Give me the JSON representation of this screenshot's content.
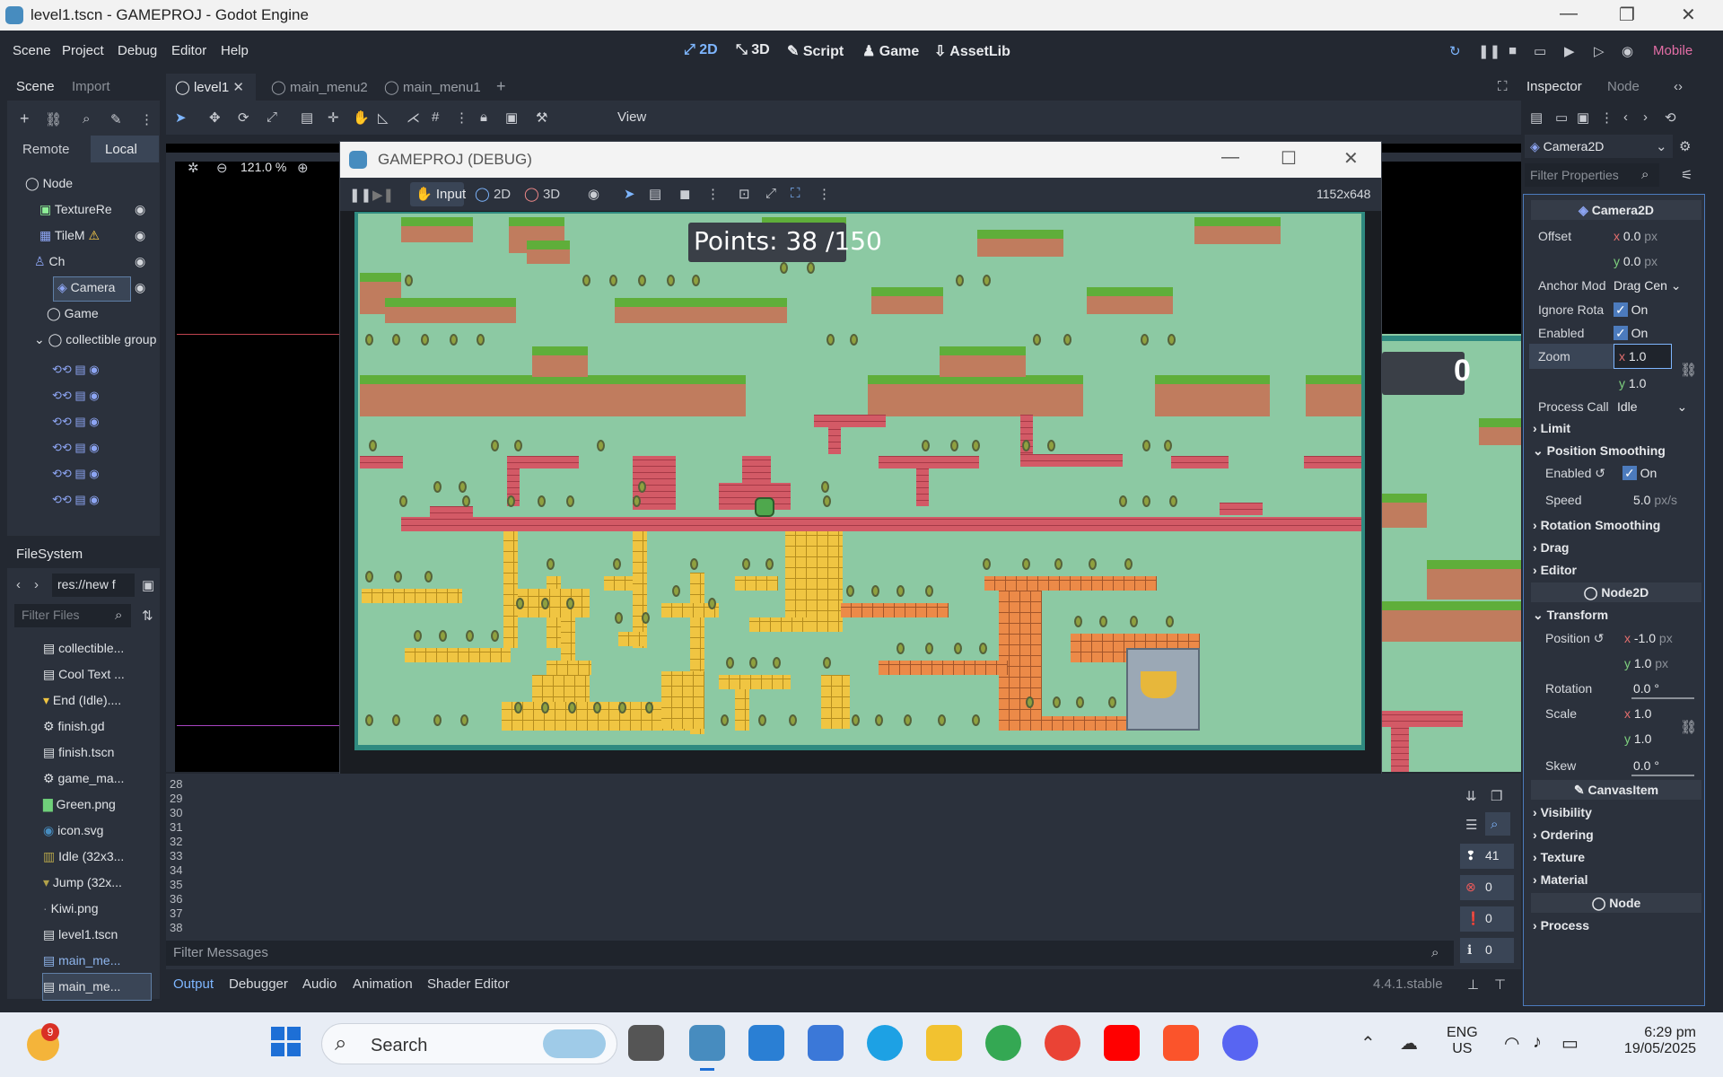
{
  "window": {
    "title": "level1.tscn - GAMEPROJ - Godot Engine"
  },
  "menu": [
    "Scene",
    "Project",
    "Debug",
    "Editor",
    "Help"
  ],
  "workspaces": [
    "2D",
    "3D",
    "Script",
    "Game",
    "AssetLib"
  ],
  "renderer": "Mobile",
  "scene_dock": {
    "tabs": [
      "Scene",
      "Import"
    ],
    "remote": "Remote",
    "local": "Local",
    "nodes": [
      {
        "label": "Node"
      },
      {
        "label": "TextureRe"
      },
      {
        "label": "TileM"
      },
      {
        "label": "Ch"
      },
      {
        "label": "Camera"
      },
      {
        "label": "Game"
      },
      {
        "label": "collectible group"
      }
    ]
  },
  "filesystem": {
    "title": "FileSystem",
    "path": "res://new f",
    "filter_placeholder": "Filter Files",
    "files": [
      "collectible...",
      "Cool Text ...",
      "End (Idle)....",
      "finish.gd",
      "finish.tscn",
      "game_ma...",
      "Green.png",
      "icon.svg",
      "Idle (32x3...",
      "Jump (32x...",
      "Kiwi.png",
      "level1.tscn",
      "main_me...",
      "main_me..."
    ]
  },
  "editor_tabs": [
    "level1",
    "main_menu2",
    "main_menu1"
  ],
  "toolbar": {
    "view": "View",
    "zoom": "121.0 %"
  },
  "game_window": {
    "title": "GAMEPROJ (DEBUG)",
    "input": "Input",
    "mode2d": "2D",
    "mode3d": "3D",
    "resolution": "1152x648",
    "points": "Points: 38 /150"
  },
  "side_score": "0",
  "output": {
    "lines": [
      "28",
      "29",
      "30",
      "31",
      "32",
      "33",
      "34",
      "35",
      "36",
      "37",
      "38"
    ],
    "filter_placeholder": "Filter Messages",
    "counts": [
      "41",
      "0",
      "0",
      "0"
    ],
    "tabs": [
      "Output",
      "Debugger",
      "Audio",
      "Animation",
      "Shader Editor"
    ],
    "version": "4.4.1.stable"
  },
  "inspector": {
    "tabs": [
      "Inspector",
      "Node"
    ],
    "node_type": "Camera2D",
    "filter_placeholder": "Filter Properties",
    "header": "Camera2D",
    "offset_label": "Offset",
    "offset_x": "0.0",
    "offset_y": "0.0",
    "px": "px",
    "anchor_label": "Anchor Mod",
    "anchor_value": "Drag Cen",
    "ignore_label": "Ignore Rota",
    "ignore_value": "On",
    "enabled_label": "Enabled",
    "enabled_value": "On",
    "zoom_label": "Zoom",
    "zoom_x": "1.0",
    "zoom_y": "1.0",
    "process_label": "Process Call",
    "process_value": "Idle",
    "limit": "Limit",
    "pos_smoothing": "Position Smoothing",
    "ps_enabled_label": "Enabled",
    "ps_enabled_value": "On",
    "speed_label": "Speed",
    "speed_value": "5.0",
    "speed_unit": "px/s",
    "rot_smoothing": "Rotation Smoothing",
    "drag": "Drag",
    "editor": "Editor",
    "node2d": "Node2D",
    "transform": "Transform",
    "position_label": "Position",
    "pos_x": "-1.0",
    "pos_y": "1.0",
    "rotation_label": "Rotation",
    "rotation_value": "0.0",
    "scale_label": "Scale",
    "scale_x": "1.0",
    "scale_y": "1.0",
    "skew_label": "Skew",
    "skew_value": "0.0",
    "canvasitem": "CanvasItem",
    "visibility": "Visibility",
    "ordering": "Ordering",
    "texture": "Texture",
    "material": "Material",
    "node": "Node",
    "process": "Process"
  },
  "taskbar": {
    "search": "Search",
    "lang1": "ENG",
    "lang2": "US",
    "time": "6:29 pm",
    "date": "19/05/2025",
    "weather_badge": "9"
  },
  "colors": {
    "accent": "#478cbf",
    "bg": "#232831",
    "panel": "#2b313c",
    "ground": "#c07c5e",
    "grass": "#5fae3a",
    "brick": "#d35a66",
    "gold": "#f0c542"
  }
}
